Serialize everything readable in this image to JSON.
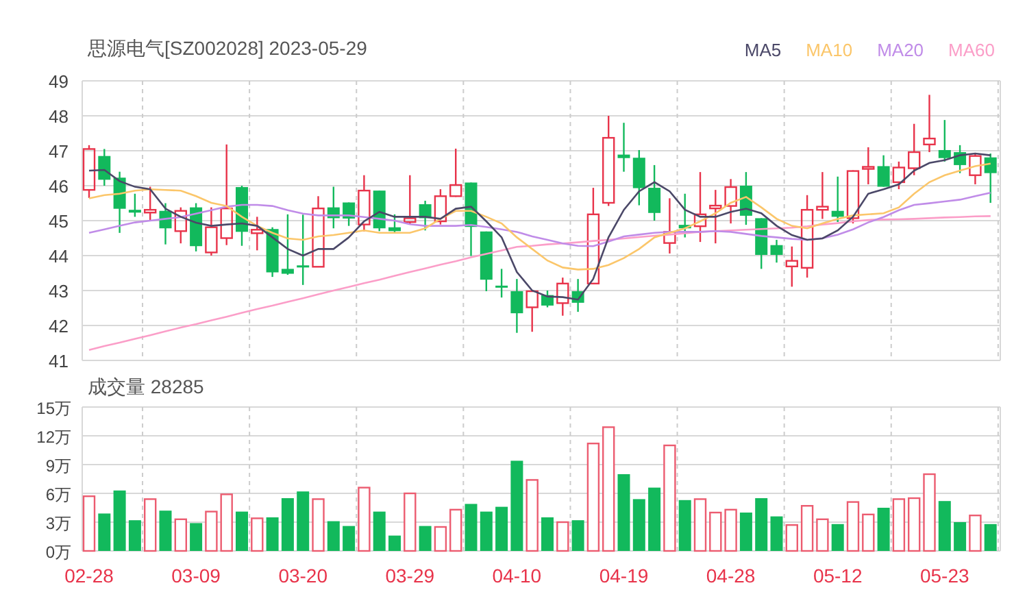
{
  "price_chart": {
    "chart_data": {
      "type": "candlestick",
      "title": "思源电气[SZ002028] 2023-05-29",
      "ylim": [
        41,
        49
      ],
      "yticks": [
        41,
        42,
        43,
        44,
        45,
        46,
        47,
        48,
        49
      ],
      "grid": true,
      "categories": [
        null,
        null,
        null,
        null,
        null,
        null,
        null,
        null,
        null,
        null,
        null,
        null,
        null,
        null,
        null,
        null,
        null,
        null,
        null,
        null,
        null,
        null,
        null,
        null,
        null,
        null,
        null,
        null,
        null,
        null,
        null,
        null,
        null,
        null,
        null,
        null,
        null,
        null,
        null,
        null,
        null,
        null,
        null,
        null,
        null,
        null,
        null,
        null,
        null,
        null,
        null,
        null,
        null,
        null,
        null,
        null,
        null,
        null,
        null,
        null
      ],
      "ohlc": [
        [
          45.88,
          47.16,
          45.65,
          47.05
        ],
        [
          46.85,
          47.05,
          46.0,
          46.17
        ],
        [
          46.23,
          46.4,
          44.65,
          45.34
        ],
        [
          45.31,
          45.77,
          45.11,
          45.23
        ],
        [
          45.23,
          45.97,
          45.0,
          45.31
        ],
        [
          45.28,
          45.5,
          44.32,
          44.78
        ],
        [
          44.7,
          45.38,
          44.35,
          45.28
        ],
        [
          45.38,
          45.5,
          44.12,
          44.27
        ],
        [
          44.09,
          45.38,
          44.0,
          44.81
        ],
        [
          44.5,
          47.18,
          44.3,
          45.35
        ],
        [
          45.96,
          46.0,
          44.28,
          44.68
        ],
        [
          44.64,
          45.11,
          44.15,
          44.74
        ],
        [
          44.76,
          44.81,
          43.39,
          43.52
        ],
        [
          43.62,
          45.18,
          43.45,
          43.48
        ],
        [
          43.72,
          45.17,
          43.16,
          43.66
        ],
        [
          43.68,
          45.7,
          43.68,
          45.35
        ],
        [
          45.38,
          45.97,
          44.78,
          45.07
        ],
        [
          45.52,
          45.52,
          44.85,
          45.06
        ],
        [
          44.89,
          46.3,
          44.69,
          45.86
        ],
        [
          45.86,
          45.86,
          44.7,
          44.78
        ],
        [
          44.81,
          45.18,
          44.65,
          44.7
        ],
        [
          44.96,
          46.3,
          44.89,
          45.07
        ],
        [
          45.47,
          45.57,
          44.72,
          45.07
        ],
        [
          44.98,
          45.9,
          44.89,
          45.7
        ],
        [
          45.7,
          47.06,
          45.68,
          46.02
        ],
        [
          46.09,
          46.09,
          43.99,
          44.82
        ],
        [
          44.69,
          44.69,
          42.98,
          43.31
        ],
        [
          43.14,
          43.62,
          42.8,
          43.1
        ],
        [
          42.98,
          43.33,
          41.79,
          42.35
        ],
        [
          42.52,
          43.0,
          41.82,
          42.98
        ],
        [
          42.87,
          43.0,
          42.52,
          42.57
        ],
        [
          42.64,
          43.37,
          42.28,
          43.2
        ],
        [
          42.98,
          43.33,
          42.39,
          42.65
        ],
        [
          43.2,
          45.94,
          43.18,
          45.18
        ],
        [
          45.51,
          48.0,
          45.42,
          47.37
        ],
        [
          46.89,
          47.8,
          46.4,
          46.79
        ],
        [
          46.8,
          47.02,
          45.44,
          45.93
        ],
        [
          45.94,
          46.59,
          45.0,
          45.22
        ],
        [
          44.36,
          45.64,
          44.06,
          44.68
        ],
        [
          44.88,
          45.77,
          44.52,
          44.78
        ],
        [
          44.84,
          46.39,
          44.39,
          45.18
        ],
        [
          45.35,
          45.88,
          44.35,
          45.43
        ],
        [
          45.42,
          46.19,
          44.92,
          45.96
        ],
        [
          46.0,
          46.39,
          44.88,
          45.14
        ],
        [
          45.07,
          45.07,
          43.62,
          44.02
        ],
        [
          44.3,
          44.45,
          43.8,
          44.02
        ],
        [
          43.69,
          44.26,
          43.11,
          43.85
        ],
        [
          43.65,
          45.73,
          43.37,
          45.31
        ],
        [
          45.31,
          46.39,
          45.05,
          45.4
        ],
        [
          45.28,
          46.26,
          44.96,
          45.11
        ],
        [
          45.07,
          46.44,
          44.92,
          46.42
        ],
        [
          46.48,
          47.1,
          46.04,
          46.54
        ],
        [
          46.56,
          46.87,
          45.97,
          45.97
        ],
        [
          46.1,
          46.69,
          45.9,
          46.52
        ],
        [
          46.5,
          47.77,
          46.3,
          46.96
        ],
        [
          47.18,
          48.6,
          46.96,
          47.35
        ],
        [
          47.02,
          47.88,
          46.69,
          46.79
        ],
        [
          46.96,
          47.16,
          46.36,
          46.59
        ],
        [
          46.3,
          46.92,
          46.04,
          46.85
        ],
        [
          46.81,
          46.92,
          45.51,
          46.36
        ]
      ]
    }
  },
  "moving_averages": {
    "chart_data": {
      "type": "line",
      "ylim": [
        41,
        49
      ],
      "series": [
        {
          "name": "MA5",
          "color": "#4b4868",
          "values": [
            46.43,
            46.45,
            46.13,
            45.97,
            45.9,
            45.34,
            45.11,
            44.94,
            44.85,
            44.89,
            44.92,
            44.85,
            44.52,
            44.19,
            44.0,
            44.19,
            44.19,
            44.52,
            44.98,
            45.25,
            45.11,
            45.11,
            45.11,
            45.05,
            45.34,
            45.4,
            44.98,
            44.52,
            43.53,
            43.0,
            42.83,
            42.81,
            42.74,
            43.33,
            44.52,
            45.31,
            45.84,
            46.1,
            45.84,
            45.31,
            45.11,
            45.11,
            45.25,
            45.34,
            45.21,
            44.85,
            44.59,
            44.45,
            44.49,
            44.72,
            45.11,
            45.77,
            45.9,
            46.04,
            46.43,
            46.65,
            46.73,
            46.87,
            46.92,
            46.87
          ]
        },
        {
          "name": "MA10",
          "color": "#fbc66a",
          "values": [
            45.64,
            45.73,
            45.77,
            45.86,
            45.9,
            45.88,
            45.86,
            45.7,
            45.51,
            45.42,
            45.11,
            44.85,
            44.65,
            44.49,
            44.45,
            44.55,
            44.59,
            44.65,
            44.72,
            44.65,
            44.65,
            44.65,
            44.78,
            45.05,
            45.28,
            45.28,
            45.11,
            44.92,
            44.52,
            44.19,
            43.86,
            43.66,
            43.6,
            43.62,
            43.73,
            43.93,
            44.19,
            44.52,
            44.65,
            44.78,
            44.98,
            45.21,
            45.51,
            45.68,
            45.38,
            45.05,
            44.85,
            44.78,
            44.92,
            45.05,
            45.15,
            45.18,
            45.21,
            45.38,
            45.77,
            46.1,
            46.3,
            46.43,
            46.56,
            46.63
          ]
        },
        {
          "name": "MA20",
          "color": "#c08ce8",
          "values": [
            44.65,
            44.75,
            44.85,
            44.95,
            45.0,
            45.05,
            45.1,
            45.2,
            45.3,
            45.4,
            45.45,
            45.45,
            45.42,
            45.3,
            45.2,
            45.15,
            45.15,
            45.15,
            45.1,
            45.05,
            45.0,
            44.9,
            44.85,
            44.85,
            44.85,
            44.88,
            44.82,
            44.75,
            44.68,
            44.55,
            44.45,
            44.35,
            44.28,
            44.27,
            44.4,
            44.55,
            44.6,
            44.65,
            44.68,
            44.68,
            44.68,
            44.7,
            44.68,
            44.62,
            44.56,
            44.52,
            44.48,
            44.45,
            44.5,
            44.6,
            44.75,
            44.95,
            45.1,
            45.3,
            45.45,
            45.5,
            45.55,
            45.6,
            45.7,
            45.8
          ]
        },
        {
          "name": "MA60",
          "color": "#fb9ec8",
          "values": [
            41.3,
            41.41,
            41.51,
            41.62,
            41.72,
            41.83,
            41.94,
            42.04,
            42.15,
            42.25,
            42.36,
            42.47,
            42.57,
            42.68,
            42.78,
            42.89,
            43.0,
            43.1,
            43.21,
            43.31,
            43.42,
            43.53,
            43.63,
            43.74,
            43.84,
            43.95,
            44.05,
            44.15,
            44.25,
            44.28,
            44.32,
            44.35,
            44.38,
            44.42,
            44.45,
            44.49,
            44.53,
            44.57,
            44.6,
            44.64,
            44.68,
            44.7,
            44.72,
            44.74,
            44.76,
            44.78,
            44.8,
            44.84,
            44.89,
            44.93,
            44.98,
            45.02,
            45.03,
            45.04,
            45.05,
            45.07,
            45.09,
            45.1,
            45.12,
            45.13
          ]
        }
      ]
    }
  },
  "volume_chart": {
    "chart_data": {
      "type": "bar",
      "title": "成交量 28285",
      "ylim": [
        0,
        15
      ],
      "grid": true,
      "categories": [
        "02-28",
        null,
        null,
        null,
        null,
        null,
        null,
        "03-09",
        null,
        null,
        null,
        null,
        null,
        null,
        "03-20",
        null,
        null,
        null,
        null,
        null,
        null,
        "03-29",
        null,
        null,
        null,
        null,
        null,
        null,
        "04-10",
        null,
        null,
        null,
        null,
        null,
        null,
        "04-19",
        null,
        null,
        null,
        null,
        null,
        null,
        "04-28",
        null,
        null,
        null,
        null,
        null,
        null,
        "05-12",
        null,
        null,
        null,
        null,
        null,
        null,
        "05-23",
        null,
        null,
        null
      ],
      "yticks": [
        {
          "value": 0,
          "label": "0万"
        },
        {
          "value": 3,
          "label": "3万"
        },
        {
          "value": 6,
          "label": "6万"
        },
        {
          "value": 9,
          "label": "9万"
        },
        {
          "value": 12,
          "label": "12万"
        },
        {
          "value": 15,
          "label": "15万"
        }
      ],
      "values": [
        5.7,
        3.9,
        6.3,
        3.2,
        5.4,
        4.2,
        3.3,
        2.9,
        4.1,
        5.9,
        4.1,
        3.4,
        3.5,
        5.5,
        6.2,
        5.4,
        3.1,
        2.6,
        6.6,
        4.1,
        1.6,
        6.0,
        2.6,
        2.5,
        4.3,
        4.9,
        4.1,
        4.6,
        9.4,
        7.4,
        3.5,
        3.0,
        3.2,
        11.2,
        12.9,
        8.0,
        5.4,
        6.6,
        11.0,
        5.3,
        5.4,
        4.0,
        4.3,
        4.0,
        5.5,
        3.6,
        2.7,
        4.7,
        3.3,
        2.8,
        5.1,
        3.8,
        4.5,
        5.4,
        5.5,
        8.0,
        5.2,
        3.0,
        3.7,
        2.8
      ]
    }
  }
}
